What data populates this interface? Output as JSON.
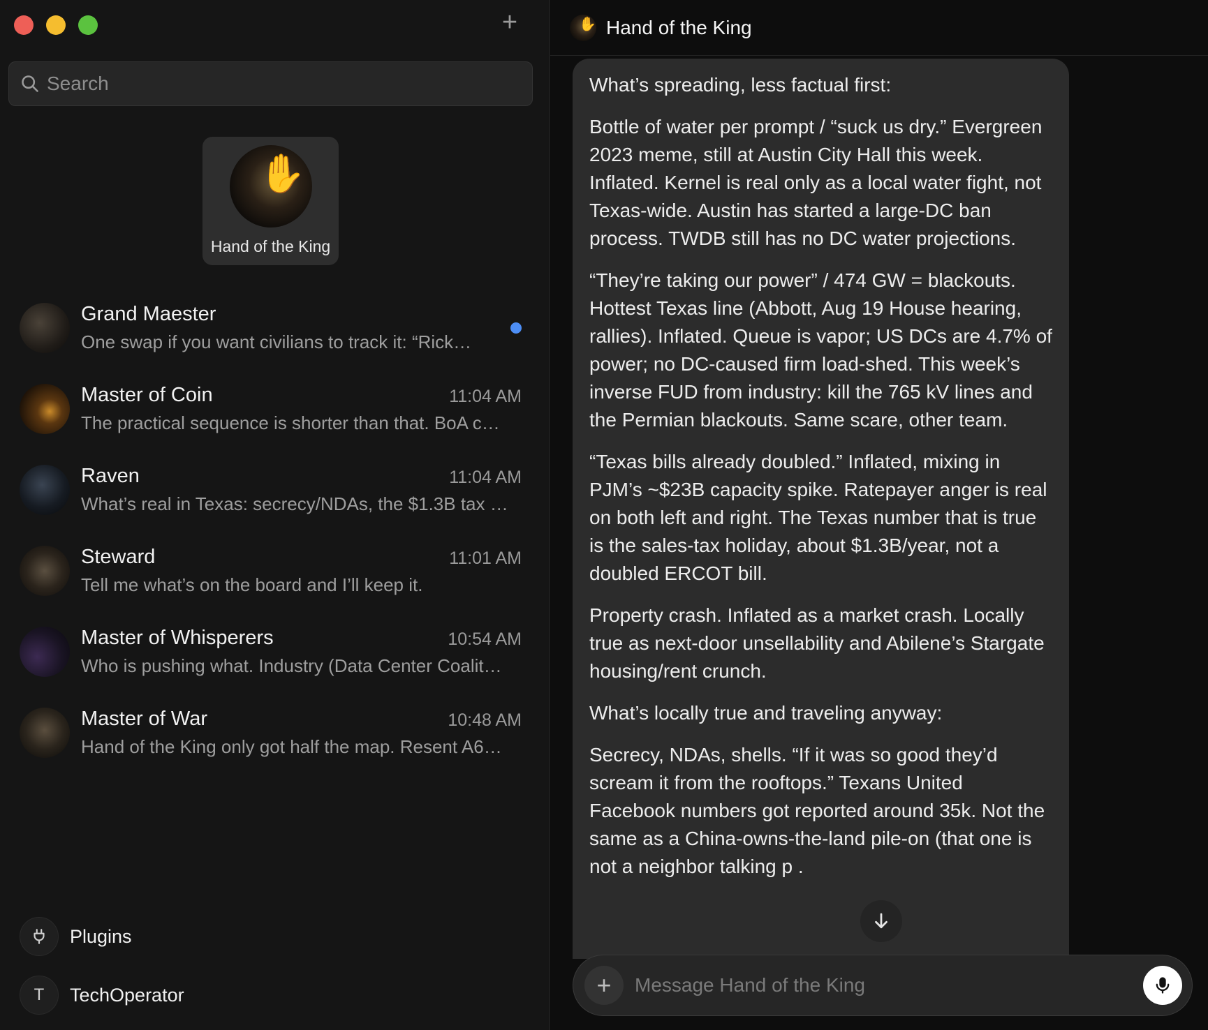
{
  "sidebar": {
    "search_placeholder": "Search",
    "pinned": {
      "name": "Hand of the King"
    },
    "conversations": [
      {
        "name": "Grand Maester",
        "time": "",
        "preview": "One swap if you want civilians to track it: “Rick…",
        "unread": true
      },
      {
        "name": "Master of Coin",
        "time": "11:04 AM",
        "preview": "The practical sequence is shorter than that. BoA c…",
        "unread": false
      },
      {
        "name": "Raven",
        "time": "11:04 AM",
        "preview": "What’s real in Texas: secrecy/NDAs, the $1.3B tax …",
        "unread": false
      },
      {
        "name": "Steward",
        "time": "11:01 AM",
        "preview": "Tell me what’s on the board and I’ll keep it.",
        "unread": false
      },
      {
        "name": "Master of Whisperers",
        "time": "10:54 AM",
        "preview": "Who is pushing what. Industry (Data Center Coalit…",
        "unread": false
      },
      {
        "name": "Master of War",
        "time": "10:48 AM",
        "preview": "Hand of the King only got half the map. Resent A6…",
        "unread": false
      }
    ],
    "plugins_label": "Plugins",
    "user": {
      "initial": "T",
      "name": "TechOperator"
    }
  },
  "main": {
    "title": "Hand of the King",
    "message": {
      "paragraphs": [
        "What’s spreading, less factual first:",
        "Bottle of water per prompt / “suck us dry.” Evergreen 2023 meme, still at Austin City Hall this week. Inflated. Kernel is real only as a local water fight, not Texas-wide. Austin has started a large-DC ban process. TWDB still has no DC water projections.",
        "“They’re taking our power” / 474 GW = blackouts. Hottest Texas line (Abbott, Aug 19 House hearing, rallies). Inflated. Queue is vapor; US DCs are 4.7% of power; no DC-caused firm load-shed. This week’s inverse FUD from industry: kill the 765 kV lines and the Permian blackouts. Same scare, other team.",
        "“Texas bills already doubled.” Inflated, mixing in PJM’s ~$23B capacity spike. Ratepayer anger is real on both left and right. The Texas number that is true is the sales-tax holiday, about $1.3B/year, not a doubled ERCOT bill.",
        "Property crash. Inflated as a market crash. Locally true as next-door unsellability and Abilene’s Stargate housing/rent crunch.",
        "What’s locally true and traveling anyway:",
        "Secrecy, NDAs, shells. “If it was so good they’d scream it from the rooftops.” Texans United Facebook numbers got reported around 35k. Not the same as a China-owns-the-land pile-on (that one is not a neighbor talking p        ."
      ]
    },
    "composer_placeholder": "Message Hand of the King"
  },
  "colors": {
    "unread_dot": "#4d8ef5",
    "traffic_red": "#ee5f57",
    "traffic_yellow": "#f5bd2f",
    "traffic_green": "#5bc23f"
  }
}
